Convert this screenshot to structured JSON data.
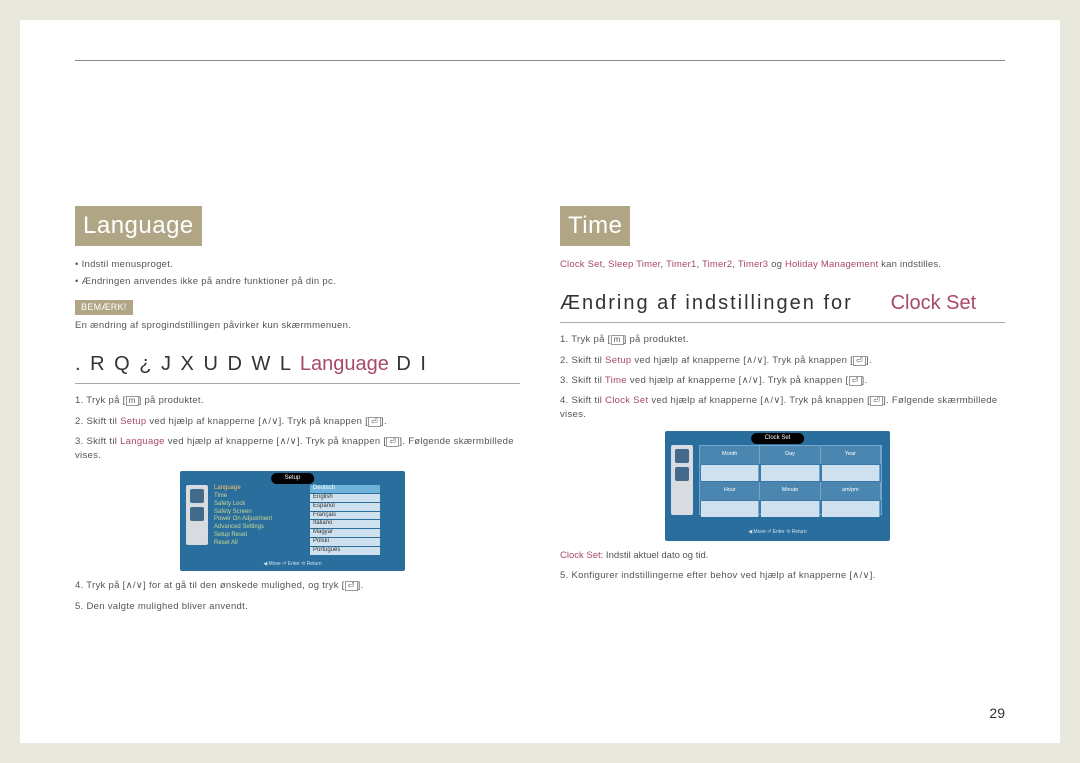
{
  "left": {
    "title": "Language",
    "bullets": [
      "Indstil menusproget.",
      "Ændringen anvendes ikke på andre funktioner på din pc."
    ],
    "noteBadge": "BEMÆRK!",
    "noteText": "En ændring af sprogindstillingen påvirker kun skærmmenuen.",
    "subheadPrefix": ". R Q ¿ J X U D W L",
    "subheadHighlight": "Language",
    "subheadSuffix": "D I",
    "steps": {
      "s1a": "Tryk på [",
      "s1b": "] på produktet.",
      "s2a": "Skift til ",
      "s2red": "Setup",
      "s2b": " ved hjælp af knapperne [",
      "s2c": "]. Tryk på knappen [",
      "s2d": "].",
      "s3a": "Skift til ",
      "s3red": "Language",
      "s3b": " ved hjælp af knapperne [",
      "s3c": "]. Tryk på knappen [",
      "s3d": "]. Følgende skærmbillede vises.",
      "s4a": "Tryk på [",
      "s4b": "] for at gå til den ønskede mulighed, og tryk [",
      "s4c": "].",
      "s5": "Den valgte mulighed bliver anvendt."
    },
    "osd": {
      "title": "Setup",
      "menu": [
        "Language",
        "Time",
        "Safety Lock",
        "Safety Screen",
        "Power On Adjustment",
        "Advanced Settings",
        "Setup Reset",
        "Reset All"
      ],
      "options": [
        "Deutsch",
        "English",
        "Español",
        "Français",
        "Italiano",
        "Magyar",
        "Polski",
        "Português"
      ],
      "footer": "◀ Move    ⏎ Enter    ⟲ Return"
    }
  },
  "right": {
    "title": "Time",
    "introParts": {
      "p1": "Clock Set",
      "p2": ", ",
      "p3": "Sleep Timer",
      "p4": ", ",
      "p5": "Timer1",
      "p6": ", ",
      "p7": "Timer2",
      "p8": ", ",
      "p9": "Timer3",
      "p10": " og ",
      "p11": "Holiday Management",
      "p12": " kan indstilles."
    },
    "subheadPrefix": "Ændring af indstillingen for",
    "subheadHighlight": "Clock Set",
    "steps": {
      "s1a": "Tryk på [",
      "s1b": "] på produktet.",
      "s2a": "Skift til ",
      "s2red": "Setup",
      "s2b": " ved hjælp af knapperne [",
      "s2c": "]. Tryk på knappen [",
      "s2d": "].",
      "s3a": "Skift til ",
      "s3red": "Time",
      "s3b": " ved hjælp af knapperne [",
      "s3c": "]. Tryk på knappen [",
      "s3d": "].",
      "s4a": "Skift til ",
      "s4red": "Clock Set",
      "s4b": " ved hjælp af knapperne [",
      "s4c": "]. Tryk på knappen [",
      "s4d": "]. Følgende skærmbillede vises.",
      "descRed": "Clock Set",
      "descText": ": Indstil aktuel dato og tid.",
      "s5": "Konfigurer indstillingerne efter behov ved hjælp af knapperne [∧/∨]."
    },
    "osd": {
      "title": "Clock Set",
      "headers1": [
        "Month",
        "Day",
        "Year"
      ],
      "headers2": [
        "Hour",
        "Minute",
        "am/pm"
      ],
      "footer": "◀ Move    ⏎ Enter    ⟲ Return"
    }
  },
  "pageNumber": "29"
}
